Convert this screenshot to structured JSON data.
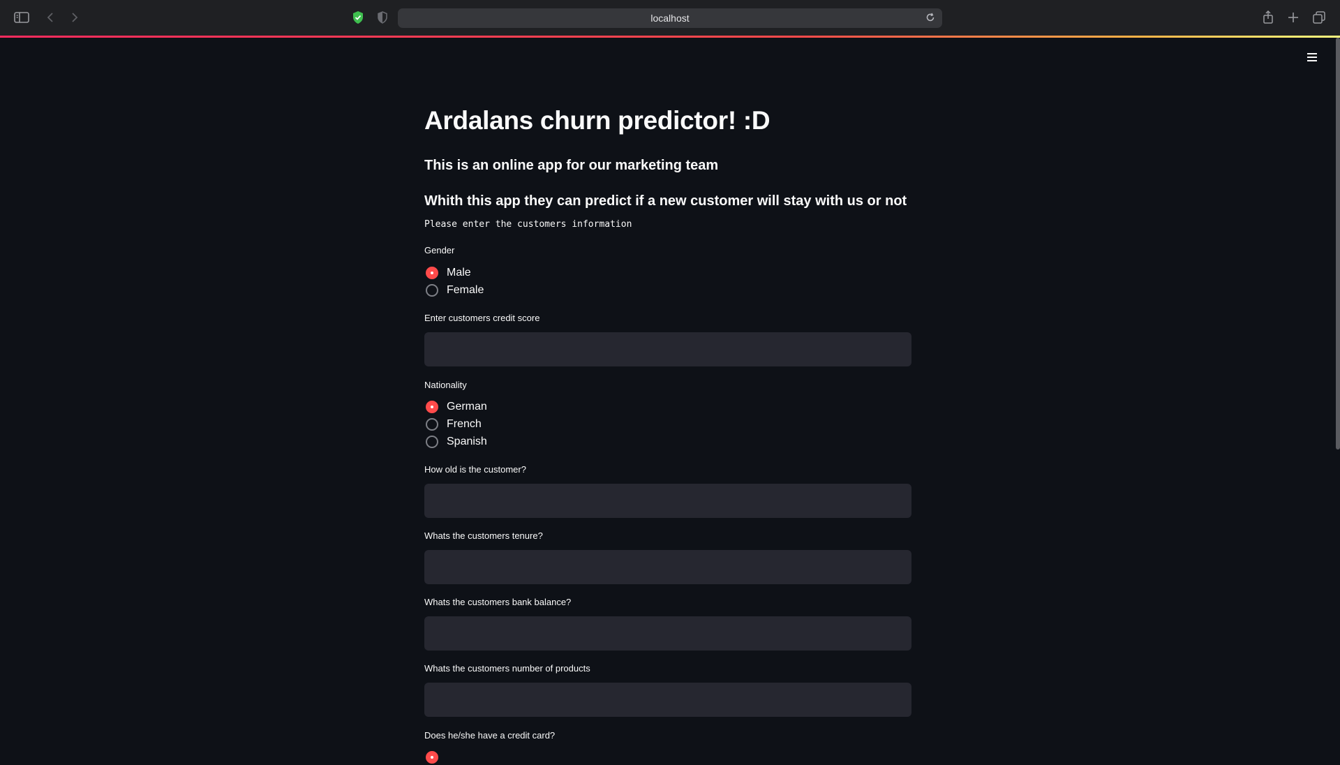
{
  "browser": {
    "url": "localhost",
    "buttons": [
      "sidebar-toggle",
      "back",
      "forward",
      "share",
      "new-tab",
      "tab-overview"
    ]
  },
  "colors": {
    "background": "#0e1117",
    "accent": "#ff4b4b",
    "input_bg": "#262730",
    "text": "#fafafa"
  },
  "page": {
    "title": "Ardalans churn predictor! :D",
    "subtitle1": "This is an online app for our marketing team",
    "subtitle2": "Whith this app they can predict if a new customer will stay with us or not",
    "instruction": "Please enter the customers information"
  },
  "form": {
    "gender": {
      "label": "Gender",
      "options": [
        "Male",
        "Female"
      ],
      "selected": "Male"
    },
    "credit_score": {
      "label": "Enter customers credit score",
      "value": ""
    },
    "nationality": {
      "label": "Nationality",
      "options": [
        "German",
        "French",
        "Spanish"
      ],
      "selected": "German"
    },
    "age": {
      "label": "How old is the customer?",
      "value": ""
    },
    "tenure": {
      "label": "Whats the customers tenure?",
      "value": ""
    },
    "balance": {
      "label": "Whats the customers bank balance?",
      "value": ""
    },
    "products": {
      "label": "Whats the customers number of products",
      "value": ""
    },
    "credit_card": {
      "label": "Does he/she have a credit card?"
    }
  }
}
